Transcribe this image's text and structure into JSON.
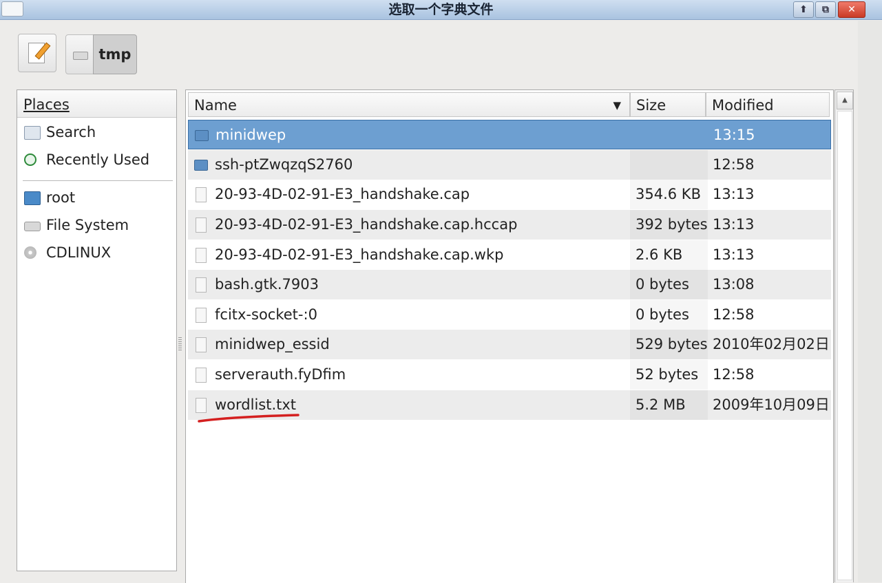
{
  "window": {
    "title": "选取一个字典文件",
    "buttons": {
      "up": "⬆",
      "restore": "⧉",
      "close": "✕"
    }
  },
  "toolbar": {
    "path_segment": "tmp"
  },
  "places": {
    "header": "Places",
    "items": [
      {
        "label": "Search",
        "icon": "search-icon"
      },
      {
        "label": "Recently Used",
        "icon": "recent-icon"
      },
      {
        "label": "root",
        "icon": "home-folder-icon"
      },
      {
        "label": "File System",
        "icon": "drive-icon"
      },
      {
        "label": "CDLINUX",
        "icon": "cdrom-icon"
      }
    ]
  },
  "filelist": {
    "columns": {
      "name": "Name",
      "size": "Size",
      "modified": "Modified"
    },
    "sort_indicator": "▼",
    "rows": [
      {
        "name": "minidwep",
        "size": "",
        "modified": "13:15",
        "type": "folder",
        "selected": true
      },
      {
        "name": "ssh-ptZwqzqS2760",
        "size": "",
        "modified": "12:58",
        "type": "folder"
      },
      {
        "name": "20-93-4D-02-91-E3_handshake.cap",
        "size": "354.6 KB",
        "modified": "13:13",
        "type": "file"
      },
      {
        "name": "20-93-4D-02-91-E3_handshake.cap.hccap",
        "size": "392 bytes",
        "modified": "13:13",
        "type": "file"
      },
      {
        "name": "20-93-4D-02-91-E3_handshake.cap.wkp",
        "size": "2.6 KB",
        "modified": "13:13",
        "type": "file"
      },
      {
        "name": "bash.gtk.7903",
        "size": "0 bytes",
        "modified": "13:08",
        "type": "file"
      },
      {
        "name": "fcitx-socket-:0",
        "size": "0 bytes",
        "modified": "12:58",
        "type": "file"
      },
      {
        "name": "minidwep_essid",
        "size": "529 bytes",
        "modified": "2010年02月02日",
        "type": "file"
      },
      {
        "name": "serverauth.fyDfim",
        "size": "52 bytes",
        "modified": "12:58",
        "type": "file"
      },
      {
        "name": "wordlist.txt",
        "size": "5.2 MB",
        "modified": "2009年10月09日",
        "type": "file"
      }
    ]
  },
  "colors": {
    "selection": "#6d9fd1",
    "annotation": "#d42020"
  }
}
